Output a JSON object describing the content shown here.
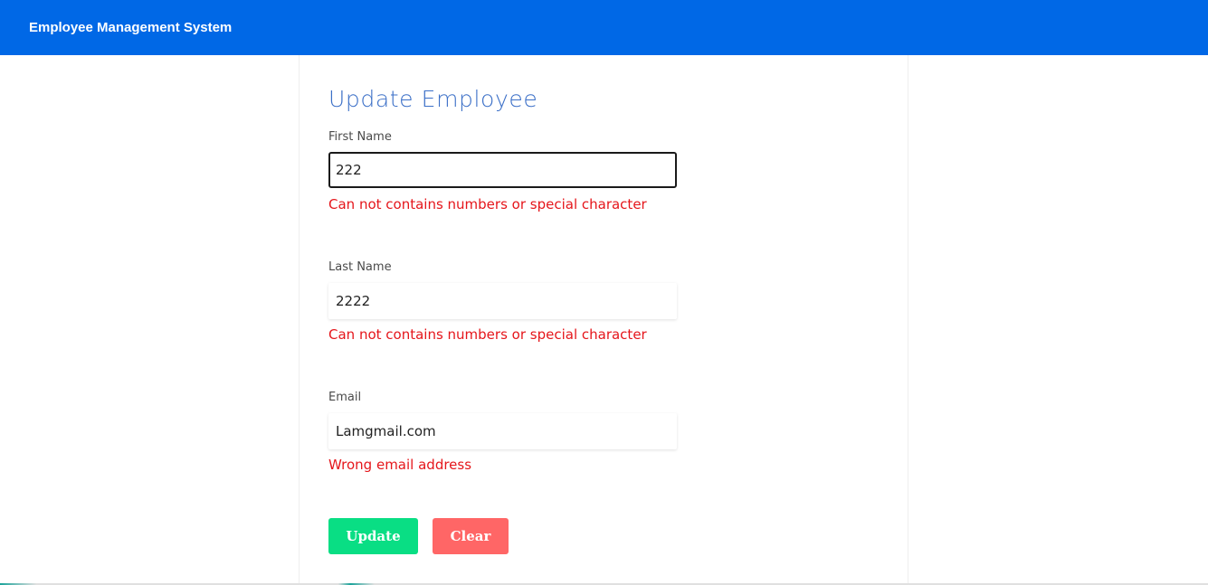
{
  "navbar": {
    "brand": "Employee Management System",
    "background": "#0068e6"
  },
  "form": {
    "title": "Update Employee",
    "fields": [
      {
        "label": "First Name",
        "value": "222",
        "error": "Can not contains numbers or special character"
      },
      {
        "label": "Last Name",
        "value": "2222",
        "error": "Can not contains numbers or special character"
      },
      {
        "label": "Email",
        "value": "Lamgmail.com",
        "error": "Wrong email address"
      }
    ],
    "buttons": {
      "update_label": "Update",
      "clear_label": "Clear"
    }
  },
  "colors": {
    "title": "#3b6fc7",
    "error": "#e5161b",
    "update_button": "#09de84",
    "clear_button": "#ff6666"
  }
}
